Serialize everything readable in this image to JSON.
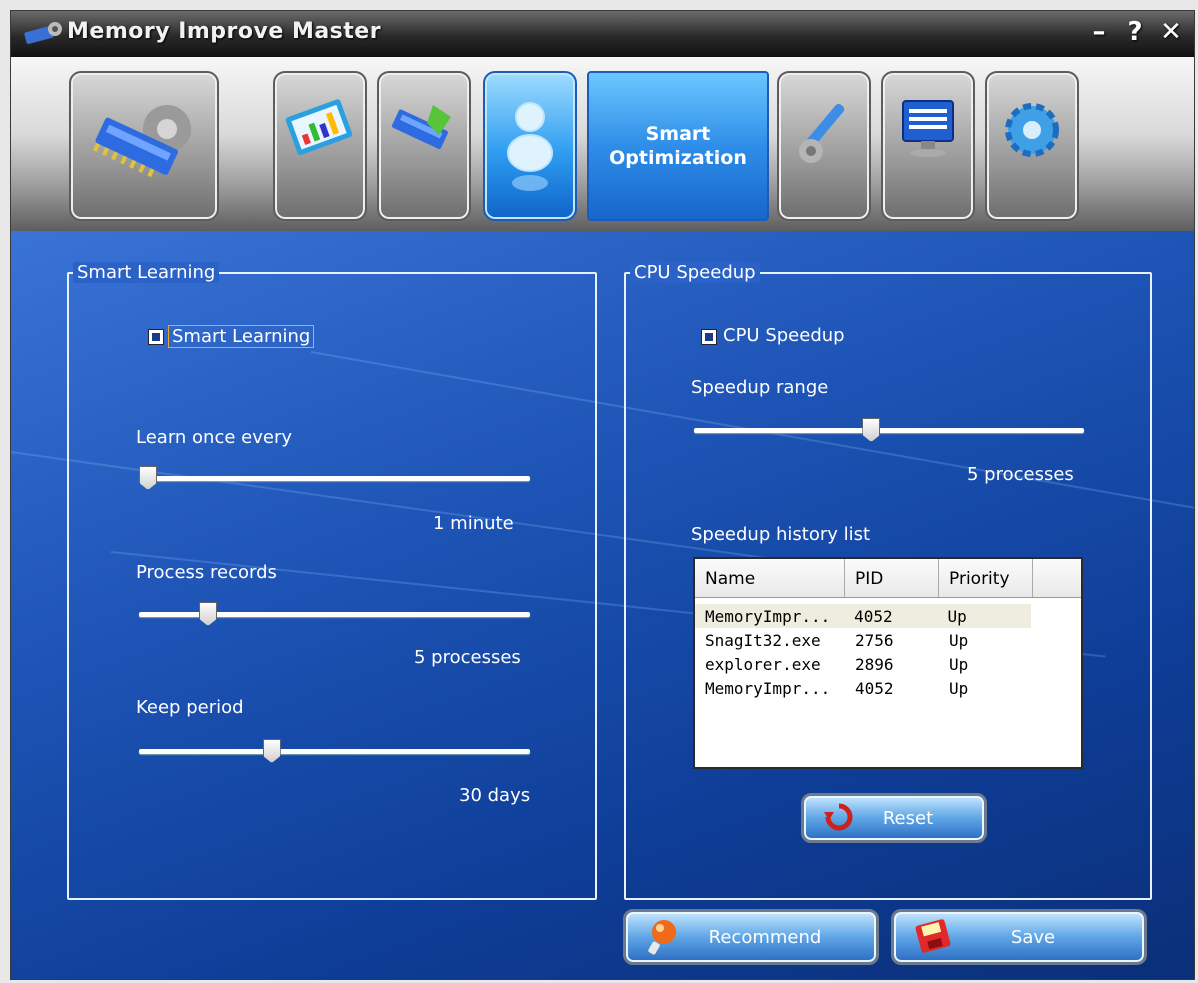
{
  "window": {
    "title": "Memory Improve Master",
    "controls": {
      "minimize": "–",
      "help": "?",
      "close": "✕"
    }
  },
  "toolbar": {
    "items": [
      {
        "icon": "memory-chip-gear-icon"
      },
      {
        "icon": "chart-monitor-icon"
      },
      {
        "icon": "memory-chip-arrow-icon"
      },
      {
        "icon": "user-optimization-icon",
        "active": true
      },
      {
        "icon": "cleaner-brush-icon"
      },
      {
        "icon": "computer-monitor-icon"
      },
      {
        "icon": "settings-gear-icon"
      }
    ],
    "active_caption": "Smart\nOptimization"
  },
  "smart_learning": {
    "group_title": "Smart Learning",
    "checkbox_label": "Smart Learning",
    "checked": true,
    "learn_once_every": {
      "label": "Learn once every",
      "value_text": "1 minute",
      "level": 0.0
    },
    "process_records": {
      "label": "Process records",
      "value_text": "5 processes",
      "level": 0.16
    },
    "keep_period": {
      "label": "Keep period",
      "value_text": "30 days",
      "level": 0.33
    }
  },
  "cpu_speedup": {
    "group_title": "CPU Speedup",
    "checkbox_label": "CPU Speedup",
    "checked": true,
    "speedup_range": {
      "label": "Speedup range",
      "value_text": "5 processes",
      "level": 0.45
    },
    "history": {
      "label": "Speedup history list",
      "columns": [
        "Name",
        "PID",
        "Priority"
      ],
      "rows": [
        [
          "MemoryImpr...",
          "4052",
          "Up"
        ],
        [
          "SnagIt32.exe",
          "2756",
          "Up"
        ],
        [
          "explorer.exe",
          "2896",
          "Up"
        ],
        [
          "MemoryImpr...",
          "4052",
          "Up"
        ]
      ]
    },
    "reset_label": "Reset"
  },
  "footer": {
    "recommend_label": "Recommend",
    "save_label": "Save"
  },
  "colors": {
    "background_blue": "#1f56b8",
    "active_tab_blue": "#2d9cf0",
    "titlebar": "#2a2a2a"
  }
}
